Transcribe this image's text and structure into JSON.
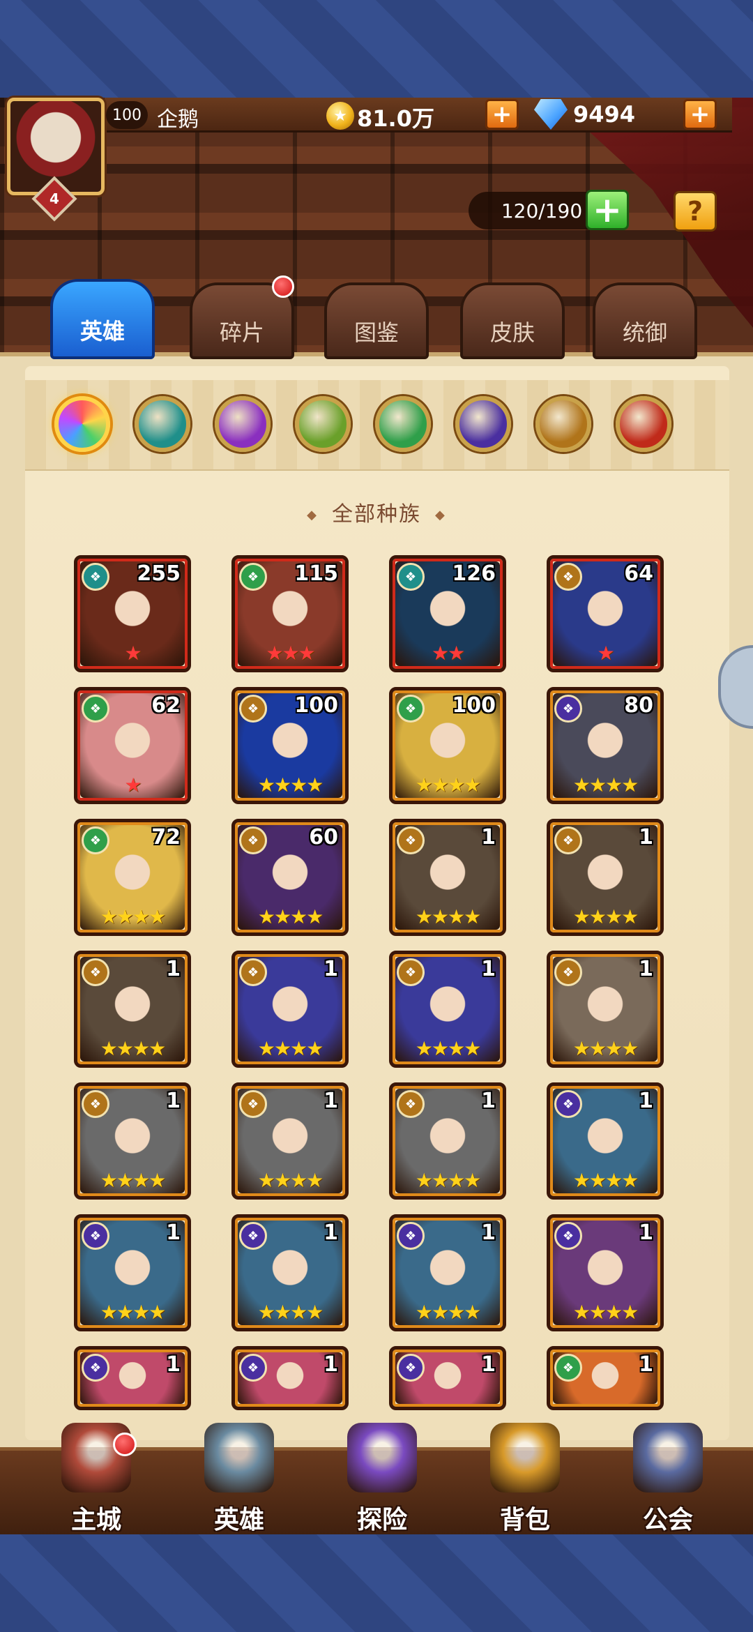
{
  "player": {
    "level": "100",
    "name": "企鹅",
    "avatar_rank": "4",
    "gold": "81.0万",
    "gems": "9494"
  },
  "capacity": "120/190",
  "help_label": "?",
  "tabs": [
    {
      "label": "英雄",
      "active": true
    },
    {
      "label": "碎片",
      "active": false,
      "badge": true
    },
    {
      "label": "图鉴",
      "active": false
    },
    {
      "label": "皮肤",
      "active": false
    },
    {
      "label": "统御",
      "active": false
    }
  ],
  "race_filters": [
    {
      "name": "all-races",
      "color": "#e84a7a",
      "active": true
    },
    {
      "name": "forest",
      "color": "#1f8f8a"
    },
    {
      "name": "shadow",
      "color": "#8a2fbf"
    },
    {
      "name": "nature",
      "color": "#6aa02a"
    },
    {
      "name": "elf",
      "color": "#2f9f4a"
    },
    {
      "name": "abyss",
      "color": "#4a2fa0"
    },
    {
      "name": "light",
      "color": "#b0741a"
    },
    {
      "name": "dark",
      "color": "#c02a1a"
    }
  ],
  "section_title": "全部种族",
  "heroes": [
    {
      "level": "255",
      "race": "forest",
      "race_color": "#1f8f8a",
      "stars": "★",
      "star_color": "red",
      "frame": "red",
      "bg": "#6a2a1a"
    },
    {
      "level": "115",
      "race": "elf",
      "race_color": "#2f9f4a",
      "stars": "★★★",
      "star_color": "red",
      "frame": "red",
      "bg": "#8a3a2a"
    },
    {
      "level": "126",
      "race": "forest",
      "race_color": "#1f8f8a",
      "stars": "★★",
      "star_color": "red",
      "frame": "red",
      "bg": "#1a3a5a"
    },
    {
      "level": "64",
      "race": "light",
      "race_color": "#b0741a",
      "stars": "★",
      "star_color": "red",
      "frame": "red",
      "bg": "#2a3a8a"
    },
    {
      "level": "62",
      "race": "elf",
      "race_color": "#2f9f4a",
      "stars": "★",
      "star_color": "red",
      "frame": "red",
      "bg": "#d88a8a"
    },
    {
      "level": "100",
      "race": "light",
      "race_color": "#b0741a",
      "stars": "★★★★",
      "star_color": "gold",
      "frame": "gold",
      "bg": "#1a3aa0"
    },
    {
      "level": "100",
      "race": "elf",
      "race_color": "#2f9f4a",
      "stars": "★★★★",
      "star_color": "gold",
      "frame": "gold",
      "bg": "#d8b040"
    },
    {
      "level": "80",
      "race": "abyss",
      "race_color": "#4a2fa0",
      "stars": "★★★★",
      "star_color": "gold",
      "frame": "gold",
      "bg": "#4a4a5a"
    },
    {
      "level": "72",
      "race": "elf",
      "race_color": "#2f9f4a",
      "stars": "★★★★",
      "star_color": "gold",
      "frame": "gold",
      "bg": "#e0b84a"
    },
    {
      "level": "60",
      "race": "light",
      "race_color": "#b0741a",
      "stars": "★★★★",
      "star_color": "gold",
      "frame": "gold",
      "bg": "#4a2a6a"
    },
    {
      "level": "1",
      "race": "light",
      "race_color": "#b0741a",
      "stars": "★★★★",
      "star_color": "gold",
      "frame": "gold",
      "bg": "#5a4a3a"
    },
    {
      "level": "1",
      "race": "light",
      "race_color": "#b0741a",
      "stars": "★★★★",
      "star_color": "gold",
      "frame": "gold",
      "bg": "#5a4a3a"
    },
    {
      "level": "1",
      "race": "light",
      "race_color": "#b0741a",
      "stars": "★★★★",
      "star_color": "gold",
      "frame": "gold",
      "bg": "#5a4a3a"
    },
    {
      "level": "1",
      "race": "light",
      "race_color": "#b0741a",
      "stars": "★★★★",
      "star_color": "gold",
      "frame": "gold",
      "bg": "#3a3a9a"
    },
    {
      "level": "1",
      "race": "light",
      "race_color": "#b0741a",
      "stars": "★★★★",
      "star_color": "gold",
      "frame": "gold",
      "bg": "#3a3a9a"
    },
    {
      "level": "1",
      "race": "light",
      "race_color": "#b0741a",
      "stars": "★★★★",
      "star_color": "gold",
      "frame": "gold",
      "bg": "#7a6a5a"
    },
    {
      "level": "1",
      "race": "light",
      "race_color": "#b0741a",
      "stars": "★★★★",
      "star_color": "gold",
      "frame": "gold",
      "bg": "#6a6a6a"
    },
    {
      "level": "1",
      "race": "light",
      "race_color": "#b0741a",
      "stars": "★★★★",
      "star_color": "gold",
      "frame": "gold",
      "bg": "#6a6a6a"
    },
    {
      "level": "1",
      "race": "light",
      "race_color": "#b0741a",
      "stars": "★★★★",
      "star_color": "gold",
      "frame": "gold",
      "bg": "#6a6a6a"
    },
    {
      "level": "1",
      "race": "abyss",
      "race_color": "#4a2fa0",
      "stars": "★★★★",
      "star_color": "gold",
      "frame": "gold",
      "bg": "#3a6a8a"
    },
    {
      "level": "1",
      "race": "abyss",
      "race_color": "#4a2fa0",
      "stars": "★★★★",
      "star_color": "gold",
      "frame": "gold",
      "bg": "#3a6a8a"
    },
    {
      "level": "1",
      "race": "abyss",
      "race_color": "#4a2fa0",
      "stars": "★★★★",
      "star_color": "gold",
      "frame": "gold",
      "bg": "#3a6a8a"
    },
    {
      "level": "1",
      "race": "abyss",
      "race_color": "#4a2fa0",
      "stars": "★★★★",
      "star_color": "gold",
      "frame": "gold",
      "bg": "#3a6a8a"
    },
    {
      "level": "1",
      "race": "abyss",
      "race_color": "#4a2fa0",
      "stars": "★★★★",
      "star_color": "gold",
      "frame": "gold",
      "bg": "#6a3a7a"
    },
    {
      "level": "1",
      "race": "abyss",
      "race_color": "#4a2fa0",
      "stars": "",
      "star_color": "gold",
      "frame": "gold",
      "bg": "#c04a6a"
    },
    {
      "level": "1",
      "race": "abyss",
      "race_color": "#4a2fa0",
      "stars": "",
      "star_color": "gold",
      "frame": "gold",
      "bg": "#c04a6a"
    },
    {
      "level": "1",
      "race": "abyss",
      "race_color": "#4a2fa0",
      "stars": "",
      "star_color": "gold",
      "frame": "gold",
      "bg": "#c04a6a"
    },
    {
      "level": "1",
      "race": "elf",
      "race_color": "#2f9f4a",
      "stars": "",
      "star_color": "gold",
      "frame": "gold",
      "bg": "#d86a2a"
    }
  ],
  "nav": [
    {
      "label": "主城",
      "icon": "castle-icon",
      "color": "#b04a3a",
      "badge": true
    },
    {
      "label": "英雄",
      "icon": "hero-icon",
      "color": "#6a8aa0"
    },
    {
      "label": "探险",
      "icon": "portal-icon",
      "color": "#7a4ac0"
    },
    {
      "label": "背包",
      "icon": "backpack-icon",
      "color": "#d89a2a"
    },
    {
      "label": "公会",
      "icon": "guild-icon",
      "color": "#5a6aa0"
    }
  ]
}
